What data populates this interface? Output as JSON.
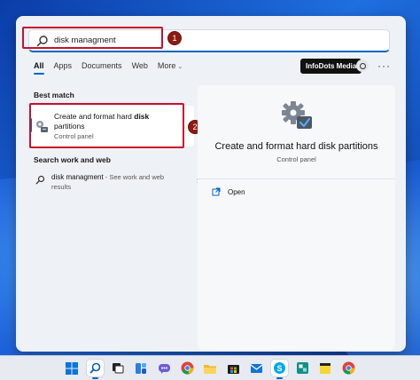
{
  "search": {
    "query": "disk managment"
  },
  "callouts": {
    "one": "1",
    "two": "2"
  },
  "filters": [
    {
      "label": "All",
      "active": true
    },
    {
      "label": "Apps"
    },
    {
      "label": "Documents"
    },
    {
      "label": "Web"
    },
    {
      "label": "More"
    }
  ],
  "profile": {
    "name": "InfoDots Media"
  },
  "best_match": {
    "heading": "Best match",
    "title_prefix": "Create and format hard ",
    "title_bold": "disk",
    "title_line2": "partitions",
    "subtitle": "Control panel"
  },
  "web": {
    "heading": "Search work and web",
    "query": "disk managment",
    "hint": " - See work and web results"
  },
  "detail": {
    "title": "Create and format hard disk partitions",
    "subtitle": "Control panel",
    "open_label": "Open"
  },
  "taskbar": {
    "icons": [
      "start-icon",
      "search-icon",
      "task-view-icon",
      "widgets-icon",
      "teams-chat-icon",
      "chrome-icon",
      "file-explorer-icon",
      "microsoft-store-icon",
      "mail-icon",
      "skype-icon",
      "sway-icon",
      "sticky-notes-icon",
      "chrome-icon"
    ]
  },
  "colors": {
    "accent": "#0067c0",
    "callout": "#c8102e",
    "badge": "#8c1c13"
  }
}
